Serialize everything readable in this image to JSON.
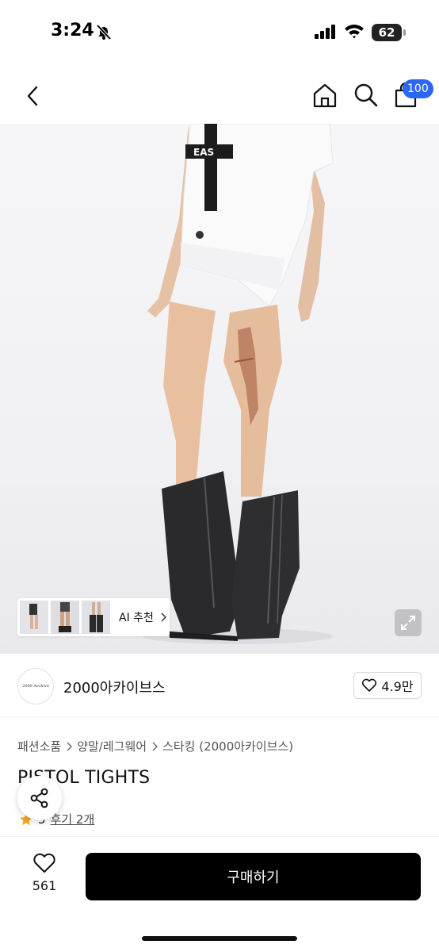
{
  "status_bar": {
    "time": "3:24",
    "battery": "62"
  },
  "header": {
    "cart_badge": "100"
  },
  "gallery": {
    "ai_recommend_label": "AI 추천"
  },
  "store": {
    "logo_text": "2000 Archive",
    "name": "2000아카이브스",
    "favorite_count": "4.9만"
  },
  "breadcrumb": [
    "패션소품",
    "양말/레그웨어",
    "스타킹 (2000아카이브스)"
  ],
  "product": {
    "title": "PISTOL TIGHTS",
    "rating": "5",
    "reviews_label": "후기 2개"
  },
  "bottom_bar": {
    "like_count": "561",
    "buy_label": "구매하기"
  },
  "colors": {
    "accent_badge": "#2b66f6",
    "buy_button": "#000000",
    "star": "#f5a623"
  }
}
